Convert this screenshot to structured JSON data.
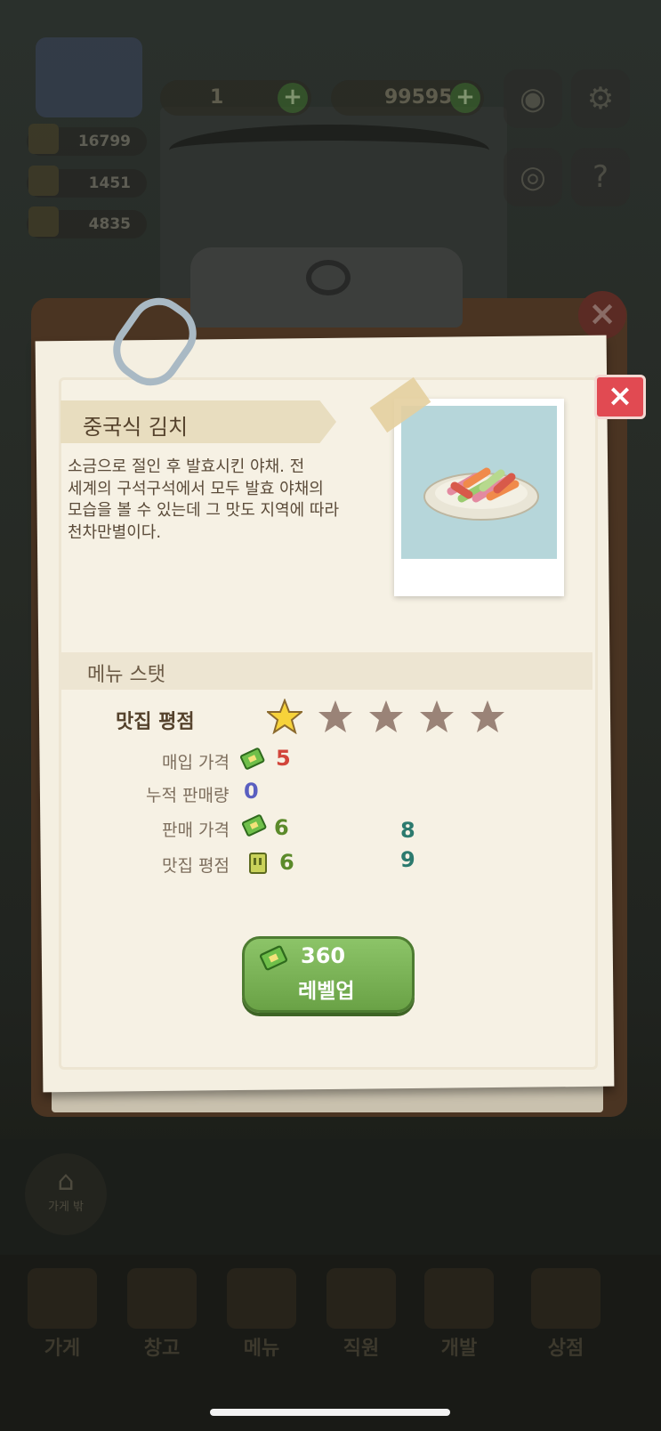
{
  "hud": {
    "gem_count": "1",
    "cash_count": "99595",
    "stats": [
      "16799",
      "1451",
      "4835"
    ],
    "store_button_label": "가게 밖"
  },
  "dish": {
    "name": "중국식 김치",
    "description_lines": [
      "소금으로 절인 후 발효시킨 야채. 전",
      "세계의 구석구석에서 모두 발효 야채의",
      "모습을 볼 수 있는데 그 맛도 지역에 따라",
      "천차만별이다."
    ]
  },
  "menu_stats": {
    "section_title": "메뉴 스탯",
    "rating_label": "맛집 평점",
    "stars_filled": 1,
    "stars_total": 5,
    "purchase_price_label": "매입 가격",
    "purchase_price": "5",
    "total_sales_label": "누적 판매량",
    "total_sales": "0",
    "sell_price_label": "판매 가격",
    "sell_price": "6",
    "sell_price_next": "8",
    "rating_score_label": "맛집 평점",
    "rating_score": "6",
    "rating_score_next": "9"
  },
  "levelup": {
    "cost": "360",
    "label": "레벨업"
  },
  "nav": [
    "가게",
    "창고",
    "메뉴",
    "직원",
    "개발",
    "상점"
  ],
  "colors": {
    "close_red": "#e14a52",
    "price_red": "#d2453a",
    "sales_blue": "#5a5fc0",
    "value_green": "#5b8a2a",
    "next_teal": "#2c7a6e",
    "button_green": "#7bb356"
  }
}
